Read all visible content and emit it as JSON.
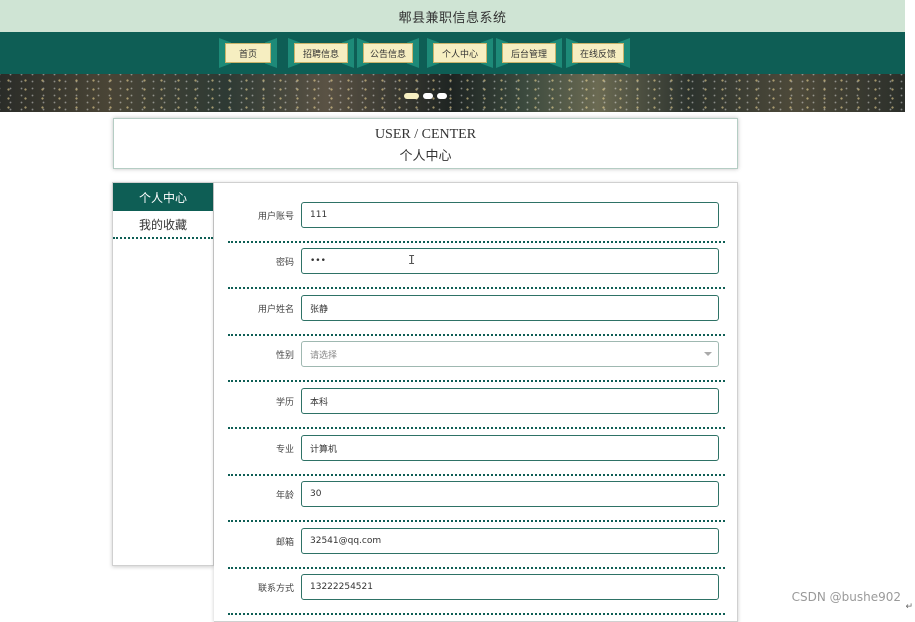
{
  "header": {
    "site_title": "郫县兼职信息系统"
  },
  "nav": {
    "items": [
      {
        "label": "首页"
      },
      {
        "label": "招聘信息"
      },
      {
        "label": "公告信息"
      },
      {
        "label": "个人中心"
      },
      {
        "label": "后台管理"
      },
      {
        "label": "在线反馈"
      }
    ]
  },
  "banner": {
    "active_slide": 1,
    "slide_count": 3
  },
  "user_center": {
    "en_title": "USER / CENTER",
    "cn_title": "个人中心"
  },
  "sidebar": {
    "items": [
      {
        "label": "个人中心",
        "active": true
      },
      {
        "label": "我的收藏",
        "active": false
      }
    ]
  },
  "form": {
    "fields": [
      {
        "label": "用户账号",
        "value": "111"
      },
      {
        "label": "密码",
        "value": "•••"
      },
      {
        "label": "用户姓名",
        "value": "张静"
      },
      {
        "label": "性别",
        "value": "",
        "placeholder": "请选择"
      },
      {
        "label": "学历",
        "value": "本科"
      },
      {
        "label": "专业",
        "value": "计算机"
      },
      {
        "label": "年龄",
        "value": "30"
      },
      {
        "label": "邮箱",
        "value": "32541@qq.com"
      },
      {
        "label": "联系方式",
        "value": "13222254521"
      }
    ]
  },
  "watermark": {
    "text": "CSDN @bushe902"
  },
  "colors": {
    "primary": "#0e5e55",
    "topbar": "#cfe4d4",
    "nav_button": "#f6eec1"
  }
}
